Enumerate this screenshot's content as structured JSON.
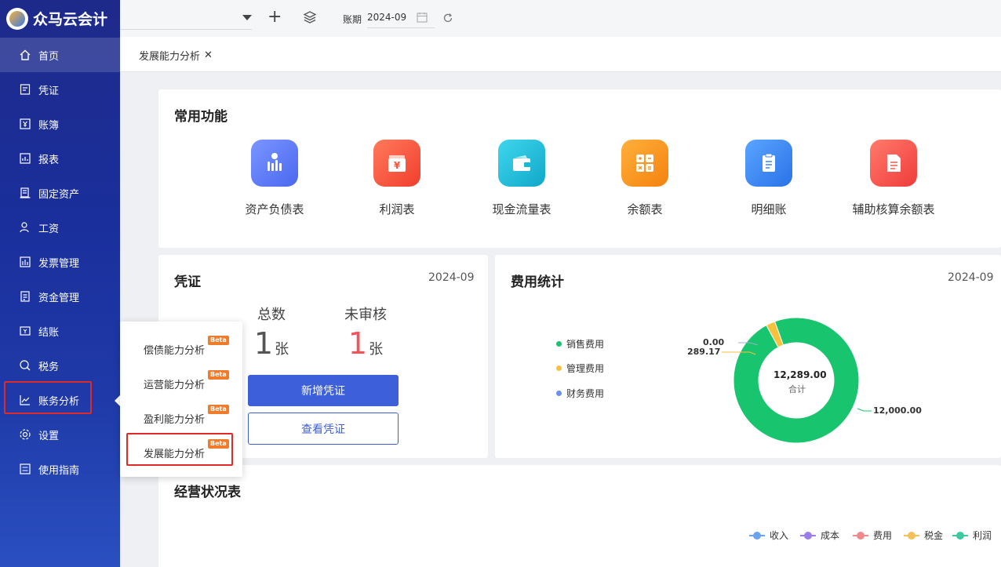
{
  "app": {
    "name": "众马云会计"
  },
  "sidebar": {
    "items": [
      {
        "label": "首页",
        "icon": "home-icon"
      },
      {
        "label": "凭证",
        "icon": "voucher-icon"
      },
      {
        "label": "账簿",
        "icon": "ledger-icon"
      },
      {
        "label": "报表",
        "icon": "report-icon"
      },
      {
        "label": "固定资产",
        "icon": "fixed-asset-icon"
      },
      {
        "label": "工资",
        "icon": "salary-icon"
      },
      {
        "label": "发票管理",
        "icon": "invoice-icon"
      },
      {
        "label": "资金管理",
        "icon": "fund-icon"
      },
      {
        "label": "结账",
        "icon": "closing-icon"
      },
      {
        "label": "税务",
        "icon": "tax-icon"
      },
      {
        "label": "账务分析",
        "icon": "analysis-icon"
      },
      {
        "label": "设置",
        "icon": "gear-icon"
      },
      {
        "label": "使用指南",
        "icon": "guide-icon"
      }
    ]
  },
  "topbar": {
    "period_label": "账期",
    "period_value": "2024-09"
  },
  "tabs": [
    {
      "label": "发展能力分析"
    }
  ],
  "common": {
    "title": "常用功能",
    "items": [
      {
        "label": "资产负债表",
        "color": "#5b7cf5"
      },
      {
        "label": "利润表",
        "color": "#f4553a"
      },
      {
        "label": "现金流量表",
        "color": "#17b9d6"
      },
      {
        "label": "余额表",
        "color": "#f7941d"
      },
      {
        "label": "明细账",
        "color": "#3b86f0"
      },
      {
        "label": "辅助核算余额表",
        "color": "#f45a4a"
      }
    ]
  },
  "voucher": {
    "title": "凭证",
    "period": "2024-09",
    "total_label": "总数",
    "total_value": "1",
    "unit": "张",
    "unreviewed_label": "未审核",
    "unreviewed_value": "1",
    "add_button": "新增凭证",
    "view_button": "查看凭证"
  },
  "expense": {
    "title": "费用统计",
    "period": "2024-09",
    "center_value": "12,289.00",
    "center_label": "合计",
    "legend": [
      {
        "label": "销售费用",
        "color": "#18c46e"
      },
      {
        "label": "管理费用",
        "color": "#f6c23e"
      },
      {
        "label": "财务费用",
        "color": "#6a8ff0"
      }
    ]
  },
  "chart_data": {
    "type": "pie",
    "categories": [
      "销售费用",
      "管理费用",
      "财务费用"
    ],
    "values": [
      12000.0,
      289.17,
      0.0
    ],
    "labels": [
      "12,000.00",
      "289.17",
      "0.00"
    ],
    "total": 12289.0,
    "legend": "left"
  },
  "business": {
    "title": "经营状况表",
    "legend": [
      {
        "label": "收入",
        "color": "#6aa3f0"
      },
      {
        "label": "成本",
        "color": "#9b7ce8"
      },
      {
        "label": "费用",
        "color": "#f08a8a"
      },
      {
        "label": "税金",
        "color": "#f5c05a"
      },
      {
        "label": "利润",
        "color": "#3cc9a0"
      }
    ]
  },
  "popup": {
    "beta": "Beta",
    "items": [
      {
        "label": "偿债能力分析"
      },
      {
        "label": "运营能力分析"
      },
      {
        "label": "盈利能力分析"
      },
      {
        "label": "发展能力分析"
      }
    ]
  }
}
